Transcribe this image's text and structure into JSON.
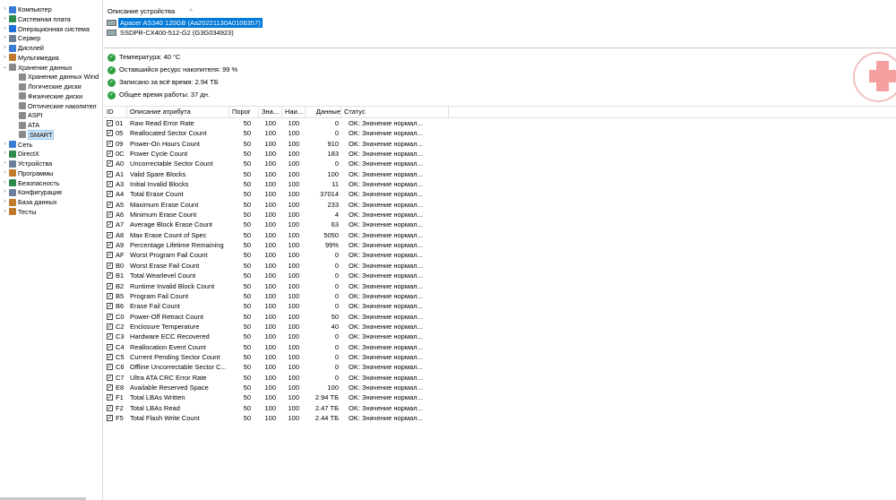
{
  "sidebar": {
    "items": [
      {
        "label": "Компьютер",
        "arrow": "›",
        "indent": 0,
        "color": "#3a7bd5"
      },
      {
        "label": "Системная плата",
        "arrow": "›",
        "indent": 0,
        "color": "#2d8a4e"
      },
      {
        "label": "Операционная система",
        "arrow": "›",
        "indent": 0,
        "color": "#1e6fd9"
      },
      {
        "label": "Сервер",
        "arrow": "›",
        "indent": 0,
        "color": "#6b7f99"
      },
      {
        "label": "Дисплей",
        "arrow": "›",
        "indent": 0,
        "color": "#3a7bd5"
      },
      {
        "label": "Мультимедиа",
        "arrow": "›",
        "indent": 0,
        "color": "#c07a2a"
      },
      {
        "label": "Хранение данных",
        "arrow": "⌄",
        "indent": 0,
        "color": "#8a8a8a"
      },
      {
        "label": "Хранение данных Wind",
        "arrow": "",
        "indent": 1,
        "color": "#8a8a8a"
      },
      {
        "label": "Логические диски",
        "arrow": "",
        "indent": 1,
        "color": "#8a8a8a"
      },
      {
        "label": "Физические диски",
        "arrow": "",
        "indent": 1,
        "color": "#8a8a8a"
      },
      {
        "label": "Оптические накопител",
        "arrow": "",
        "indent": 1,
        "color": "#8a8a8a"
      },
      {
        "label": "ASPI",
        "arrow": "",
        "indent": 1,
        "color": "#8a8a8a"
      },
      {
        "label": "ATA",
        "arrow": "",
        "indent": 1,
        "color": "#8a8a8a"
      },
      {
        "label": "SMART",
        "arrow": "",
        "indent": 1,
        "color": "#8a8a8a",
        "selected": true
      },
      {
        "label": "Сеть",
        "arrow": "›",
        "indent": 0,
        "color": "#3a7bd5"
      },
      {
        "label": "DirectX",
        "arrow": "›",
        "indent": 0,
        "color": "#2d8a4e"
      },
      {
        "label": "Устройства",
        "arrow": "›",
        "indent": 0,
        "color": "#6b7f99"
      },
      {
        "label": "Программы",
        "arrow": "›",
        "indent": 0,
        "color": "#c07a2a"
      },
      {
        "label": "Безопасность",
        "arrow": "›",
        "indent": 0,
        "color": "#2d8a4e"
      },
      {
        "label": "Конфигурация",
        "arrow": "›",
        "indent": 0,
        "color": "#6b7f99"
      },
      {
        "label": "База данных",
        "arrow": "›",
        "indent": 0,
        "color": "#c07a2a"
      },
      {
        "label": "Тесты",
        "arrow": "›",
        "indent": 0,
        "color": "#c07a2a"
      }
    ]
  },
  "devices": {
    "header": "Описание устройства",
    "sort_glyph": "^",
    "items": [
      {
        "label": "Apacer AS340 120GB (Aa20221130A0106357)",
        "selected": true
      },
      {
        "label": "SSDPR-CX400-512-G2 (G3G034923)",
        "selected": false
      }
    ]
  },
  "status": [
    "Температура: 40 °C",
    "Оставшийся ресурс накопителя: 99 %",
    "Записано за всё время: 2.94 ТБ",
    "Общее время работы: 37 дн."
  ],
  "table": {
    "headers": [
      "ID",
      "Описание атрибута",
      "Порог",
      "Зна...",
      "Наи...",
      "Данные",
      "Статус"
    ],
    "rows": [
      [
        "01",
        "Raw Read Error Rate",
        "50",
        "100",
        "100",
        "0",
        "OK: Значение нормал..."
      ],
      [
        "05",
        "Reallocated Sector Count",
        "50",
        "100",
        "100",
        "0",
        "OK: Значение нормал..."
      ],
      [
        "09",
        "Power-On Hours Count",
        "50",
        "100",
        "100",
        "910",
        "OK: Значение нормал..."
      ],
      [
        "0C",
        "Power Cycle Count",
        "50",
        "100",
        "100",
        "183",
        "OK: Значение нормал..."
      ],
      [
        "A0",
        "Uncorrectable Sector Count",
        "50",
        "100",
        "100",
        "0",
        "OK: Значение нормал..."
      ],
      [
        "A1",
        "Valid Spare Blocks",
        "50",
        "100",
        "100",
        "100",
        "OK: Значение нормал..."
      ],
      [
        "A3",
        "Initial Invalid Blocks",
        "50",
        "100",
        "100",
        "11",
        "OK: Значение нормал..."
      ],
      [
        "A4",
        "Total Erase Count",
        "50",
        "100",
        "100",
        "37014",
        "OK: Значение нормал..."
      ],
      [
        "A5",
        "Maximum Erase Count",
        "50",
        "100",
        "100",
        "233",
        "OK: Значение нормал..."
      ],
      [
        "A6",
        "Minimum Erase Count",
        "50",
        "100",
        "100",
        "4",
        "OK: Значение нормал..."
      ],
      [
        "A7",
        "Average Block Erase Count",
        "50",
        "100",
        "100",
        "63",
        "OK: Значение нормал..."
      ],
      [
        "A8",
        "Max Erase Count of Spec",
        "50",
        "100",
        "100",
        "5050",
        "OK: Значение нормал..."
      ],
      [
        "A9",
        "Percentage Lifetime Remaining",
        "50",
        "100",
        "100",
        "99%",
        "OK: Значение нормал..."
      ],
      [
        "AF",
        "Worst Program Fail Count",
        "50",
        "100",
        "100",
        "0",
        "OK: Значение нормал..."
      ],
      [
        "B0",
        "Worst Erase Fail Count",
        "50",
        "100",
        "100",
        "0",
        "OK: Значение нормал..."
      ],
      [
        "B1",
        "Total Wearlevel Count",
        "50",
        "100",
        "100",
        "0",
        "OK: Значение нормал..."
      ],
      [
        "B2",
        "Runtime Invalid Block Count",
        "50",
        "100",
        "100",
        "0",
        "OK: Значение нормал..."
      ],
      [
        "B5",
        "Program Fail Count",
        "50",
        "100",
        "100",
        "0",
        "OK: Значение нормал..."
      ],
      [
        "B6",
        "Erase Fail Count",
        "50",
        "100",
        "100",
        "0",
        "OK: Значение нормал..."
      ],
      [
        "C0",
        "Power-Off Retract Count",
        "50",
        "100",
        "100",
        "50",
        "OK: Значение нормал..."
      ],
      [
        "C2",
        "Enclosure Temperature",
        "50",
        "100",
        "100",
        "40",
        "OK: Значение нормал..."
      ],
      [
        "C3",
        "Hardware ECC Recovered",
        "50",
        "100",
        "100",
        "0",
        "OK: Значение нормал..."
      ],
      [
        "C4",
        "Reallocation Event Count",
        "50",
        "100",
        "100",
        "0",
        "OK: Значение нормал..."
      ],
      [
        "C5",
        "Current Pending Sector Count",
        "50",
        "100",
        "100",
        "0",
        "OK: Значение нормал..."
      ],
      [
        "C6",
        "Offline Uncorrectable Sector C...",
        "50",
        "100",
        "100",
        "0",
        "OK: Значение нормал..."
      ],
      [
        "C7",
        "Ultra ATA CRC Error Rate",
        "50",
        "100",
        "100",
        "0",
        "OK: Значение нормал..."
      ],
      [
        "E8",
        "Available Reserved Space",
        "50",
        "100",
        "100",
        "100",
        "OK: Значение нормал..."
      ],
      [
        "F1",
        "Total LBAs Written",
        "50",
        "100",
        "100",
        "2.94 ТБ",
        "OK: Значение нормал..."
      ],
      [
        "F2",
        "Total LBAs Read",
        "50",
        "100",
        "100",
        "2.47 ТБ",
        "OK: Значение нормал..."
      ],
      [
        "F5",
        "Total Flash Write Count",
        "50",
        "100",
        "100",
        "2.44 ТБ",
        "OK: Значение нормал..."
      ]
    ]
  }
}
